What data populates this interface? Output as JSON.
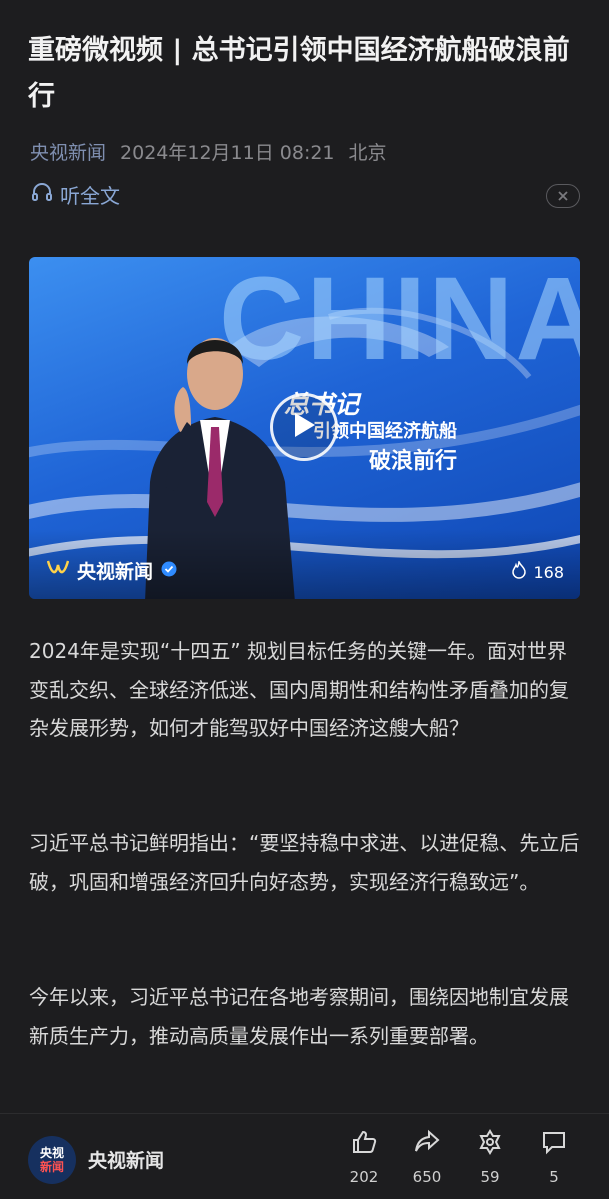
{
  "article": {
    "title": "重磅微视频 | 总书记引领中国经济航船破浪前行",
    "source": "央视新闻",
    "datetime": "2024年12月11日 08:21",
    "location": "北京",
    "listen_label": "听全文"
  },
  "video": {
    "bg_text": "CHINA",
    "headline_line1": "总书记",
    "headline_line2": "引领中国经济航船",
    "headline_line3": "破浪前行",
    "brand": "央视新闻",
    "like_count": "168"
  },
  "paragraphs": [
    "2024年是实现“十四五” 规划目标任务的关键一年。面对世界变乱交织、全球经济低迷、国内周期性和结构性矛盾叠加的复杂发展形势，如何才能驾驭好中国经济这艘大船？",
    "习近平总书记鲜明指出：“要坚持稳中求进、以进促稳、先立后破，巩固和增强经济回升向好态势，实现经济行稳致远”。",
    "今年以来，习近平总书记在各地考察期间，围绕因地制宜发展新质生产力，推动高质量发展作出一系列重要部署。"
  ],
  "footer": {
    "logo_top": "央视",
    "logo_bottom": "新闻",
    "account_name": "央视新闻",
    "actions": [
      {
        "icon": "thumbs-up-icon",
        "count": "202"
      },
      {
        "icon": "share-icon",
        "count": "650"
      },
      {
        "icon": "recommend-icon",
        "count": "59"
      },
      {
        "icon": "comment-icon",
        "count": "5"
      }
    ]
  },
  "colors": {
    "background": "#1d1d1f",
    "accent": "#8aa7d4",
    "video_blue": "#1f64d6"
  }
}
